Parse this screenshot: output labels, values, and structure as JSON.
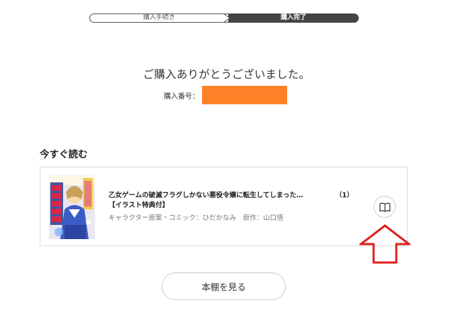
{
  "steps": {
    "step1": "購入手続き",
    "step2": "購入完了",
    "active": 2
  },
  "thanks_message": "ご購入ありがとうございました。",
  "order": {
    "label": "購入番号：",
    "value": "",
    "redaction_color": "#ff8127"
  },
  "read_now": {
    "section_title": "今すぐ読む",
    "book": {
      "title": "乙女ゲームの破滅フラグしかない悪役令嬢に転生してしまった…",
      "title_line2": "【イラスト特典付】",
      "volume": "（1）",
      "author": "キャラクター原案・コミック：ひだかなみ　原作：山口悟",
      "cover_icon": "book-cover-image",
      "read_icon": "open-book-icon"
    }
  },
  "bookshelf_button": "本棚を見る",
  "annotation": {
    "icon": "up-arrow-outline",
    "color": "#e02020"
  }
}
